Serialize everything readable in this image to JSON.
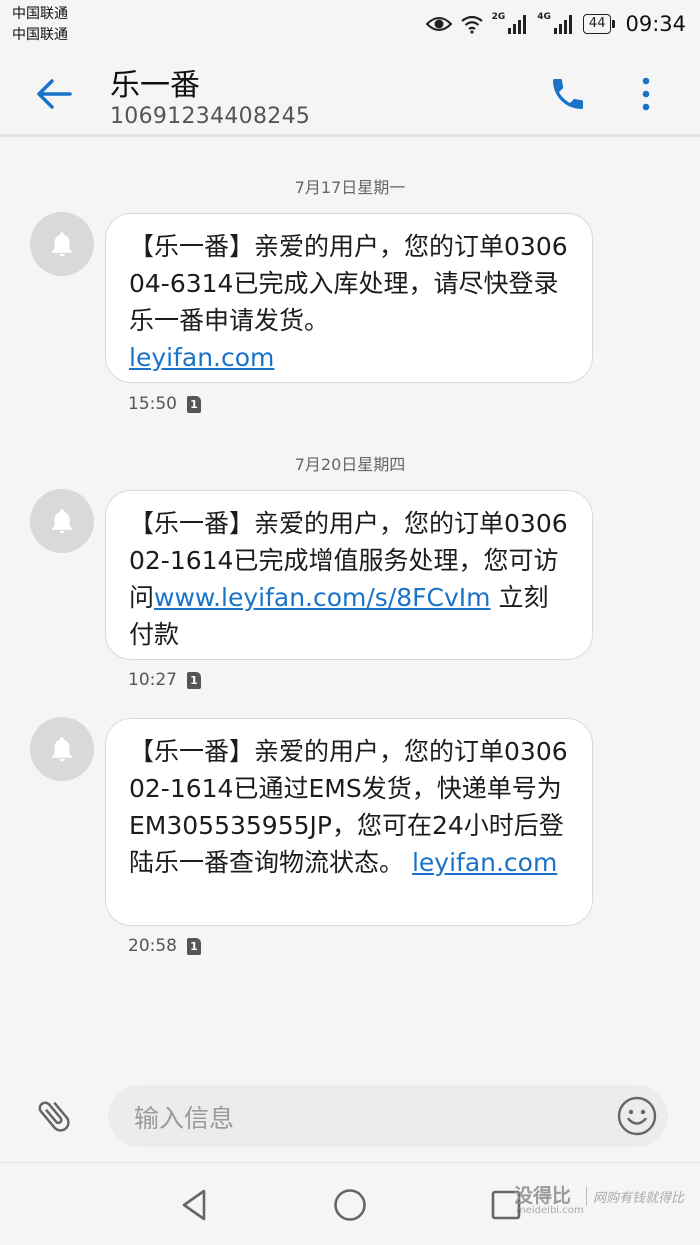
{
  "status_bar": {
    "carrier_1": "中国联通",
    "carrier_2": "中国联通",
    "net_1": "2G",
    "net_2": "4G",
    "battery": "44",
    "time": "09:34"
  },
  "header": {
    "contact_name": "乐一番",
    "contact_number": "10691234408245"
  },
  "messages": [
    {
      "date": "7月17日星期一",
      "text": "【乐一番】亲爱的用户，您的订单030604-6314已完成入库处理，请尽快登录乐一番申请发货。",
      "link_1": "leyifan.com",
      "text_after": "",
      "time": "15:50",
      "sim": "1"
    },
    {
      "date": "7月20日星期四",
      "text": "【乐一番】亲爱的用户，您的订单030602-1614已完成增值服务处理，您可访问",
      "link_1": "www.leyifan.com/s/8FCvIm",
      "text_after": " 立刻付款",
      "time": "10:27",
      "sim": "1"
    },
    {
      "date": "",
      "text": "【乐一番】亲爱的用户，您的订单030602-1614已通过EMS发货，快递单号为EM305535955JP，您可在24小时后登陆乐一番查询物流状态。 ",
      "link_1": "leyifan.com",
      "text_after": "",
      "time": "20:58",
      "sim": "1"
    }
  ],
  "composer": {
    "placeholder": "输入信息"
  },
  "watermark": {
    "main": "没得比",
    "sub": "meideibi.com",
    "slogan": "网购有钱就得比"
  },
  "colors": {
    "accent": "#1a73c9",
    "bubble_bg": "#ffffff",
    "page_bg": "#f5f5f5"
  },
  "icons": [
    "back-arrow-icon",
    "phone-icon",
    "more-vert-icon",
    "bell-icon",
    "sim-card-icon",
    "paperclip-icon",
    "emoji-icon",
    "nav-back-icon",
    "nav-home-icon",
    "nav-recent-icon"
  ]
}
